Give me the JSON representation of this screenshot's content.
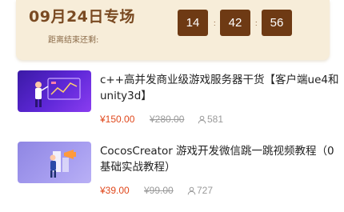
{
  "promo": {
    "title": "09月24日专场",
    "countdown_label": "距离结束还剩:",
    "hours": "14",
    "minutes": "42",
    "seconds": "56",
    "separator": ":"
  },
  "courses": [
    {
      "title": "c++高并发商业级游戏服务器干货【客户端ue4和unity3d】",
      "price": "¥150.00",
      "original_price": "¥280.00",
      "views": "581",
      "thumb_color": "#4a1fc4"
    },
    {
      "title": "CocosCreator 游戏开发微信跳一跳视频教程（0基础实战教程）",
      "price": "¥39.00",
      "original_price": "¥99.00",
      "views": "727",
      "thumb_color": "#9c94ea"
    }
  ],
  "colors": {
    "accent_price": "#e0481c",
    "timer_bg": "#6e3a14",
    "promo_bg": "#f7edd9"
  }
}
